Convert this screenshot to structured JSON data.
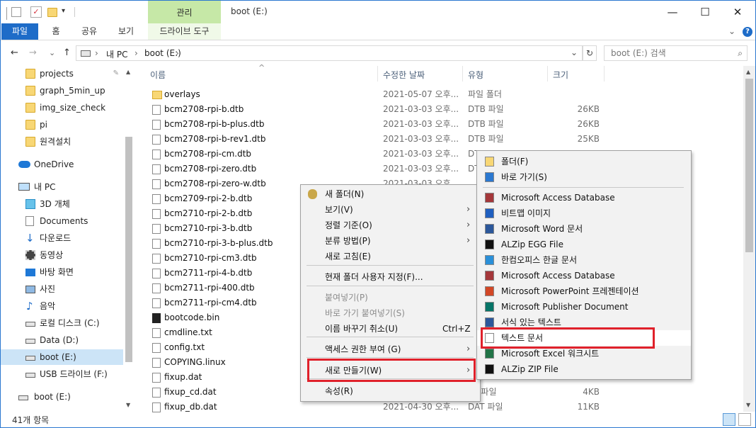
{
  "window": {
    "title": "boot (E:)",
    "context_tab": "관리",
    "minimize": "—",
    "maximize": "☐",
    "close": "✕"
  },
  "ribbon": {
    "tabs": [
      "파일",
      "홈",
      "공유",
      "보기"
    ],
    "context_tab": "드라이브 도구",
    "collapse_icon": "⌄",
    "help_icon": "?"
  },
  "address": {
    "back": "←",
    "forward": "→",
    "recent": "⌄",
    "up": "↑",
    "crumbs": [
      "내 PC",
      "boot (E:)"
    ],
    "sep": "›",
    "dropdown": "⌄",
    "refresh": "↻",
    "search_placeholder": "boot (E:) 검색",
    "search_icon": "⌕"
  },
  "nav": {
    "quick": [
      "projects",
      "graph_5min_up",
      "img_size_check",
      "pi",
      "원격설치"
    ],
    "onedrive": "OneDrive",
    "thispc": "내 PC",
    "pc_items": [
      "3D 개체",
      "Documents",
      "다운로드",
      "동영상",
      "바탕 화면",
      "사진",
      "음악",
      "로컬 디스크 (C:)",
      "Data (D:)",
      "boot (E:)",
      "USB 드라이브 (F:)"
    ],
    "bottom": "boot (E:)",
    "pin_icon": "📌"
  },
  "columns": {
    "name": "이름",
    "date": "수정한 날짜",
    "type": "유형",
    "size": "크기",
    "sort_arrow": "^"
  },
  "files": [
    {
      "name": "overlays",
      "date": "2021-05-07 오후...",
      "type": "파일 폴더",
      "size": "",
      "kind": "folder"
    },
    {
      "name": "bcm2708-rpi-b.dtb",
      "date": "2021-03-03 오후...",
      "type": "DTB 파일",
      "size": "26KB",
      "kind": "file"
    },
    {
      "name": "bcm2708-rpi-b-plus.dtb",
      "date": "2021-03-03 오후...",
      "type": "DTB 파일",
      "size": "26KB",
      "kind": "file"
    },
    {
      "name": "bcm2708-rpi-b-rev1.dtb",
      "date": "2021-03-03 오후...",
      "type": "DTB 파일",
      "size": "25KB",
      "kind": "file"
    },
    {
      "name": "bcm2708-rpi-cm.dtb",
      "date": "2021-03-03 오후...",
      "type": "DT",
      "size": "",
      "kind": "file"
    },
    {
      "name": "bcm2708-rpi-zero.dtb",
      "date": "2021-03-03 오후...",
      "type": "DT",
      "size": "",
      "kind": "file"
    },
    {
      "name": "bcm2708-rpi-zero-w.dtb",
      "date": "2021-03-03 오후...",
      "type": "",
      "size": "",
      "kind": "file"
    },
    {
      "name": "bcm2709-rpi-2-b.dtb",
      "date": "",
      "type": "",
      "size": "",
      "kind": "file"
    },
    {
      "name": "bcm2710-rpi-2-b.dtb",
      "date": "",
      "type": "",
      "size": "",
      "kind": "file"
    },
    {
      "name": "bcm2710-rpi-3-b.dtb",
      "date": "",
      "type": "",
      "size": "",
      "kind": "file"
    },
    {
      "name": "bcm2710-rpi-3-b-plus.dtb",
      "date": "",
      "type": "",
      "size": "",
      "kind": "file"
    },
    {
      "name": "bcm2710-rpi-cm3.dtb",
      "date": "",
      "type": "",
      "size": "",
      "kind": "file"
    },
    {
      "name": "bcm2711-rpi-4-b.dtb",
      "date": "",
      "type": "",
      "size": "",
      "kind": "file"
    },
    {
      "name": "bcm2711-rpi-400.dtb",
      "date": "",
      "type": "",
      "size": "",
      "kind": "file"
    },
    {
      "name": "bcm2711-rpi-cm4.dtb",
      "date": "",
      "type": "",
      "size": "",
      "kind": "file"
    },
    {
      "name": "bootcode.bin",
      "date": "",
      "type": "",
      "size": "",
      "kind": "bin"
    },
    {
      "name": "cmdline.txt",
      "date": "",
      "type": "",
      "size": "",
      "kind": "file"
    },
    {
      "name": "config.txt",
      "date": "",
      "type": "",
      "size": "",
      "kind": "file"
    },
    {
      "name": "COPYING.linux",
      "date": "",
      "type": "",
      "size": "",
      "kind": "file"
    },
    {
      "name": "fixup.dat",
      "date": "",
      "type": "",
      "size": "",
      "kind": "file"
    },
    {
      "name": "fixup_cd.dat",
      "date": "",
      "type": "AT 파일",
      "size": "4KB",
      "kind": "file"
    },
    {
      "name": "fixup_db.dat",
      "date": "2021-04-30 오후...",
      "type": "DAT 파일",
      "size": "11KB",
      "kind": "file"
    }
  ],
  "status": {
    "count": "41개 항목"
  },
  "context_menu": {
    "items": [
      {
        "label": "새 폴더(N)",
        "shortcut": "",
        "arrow": "",
        "disabled": false
      },
      {
        "label": "보기(V)",
        "shortcut": "",
        "arrow": "›",
        "disabled": false
      },
      {
        "label": "정렬 기준(O)",
        "shortcut": "",
        "arrow": "›",
        "disabled": false
      },
      {
        "label": "분류 방법(P)",
        "shortcut": "",
        "arrow": "›",
        "disabled": false
      },
      {
        "label": "새로 고침(E)",
        "shortcut": "",
        "arrow": "",
        "disabled": false
      },
      {
        "label": "현재 폴더 사용자 지정(F)...",
        "shortcut": "",
        "arrow": "",
        "disabled": false
      },
      {
        "label": "붙여넣기(P)",
        "shortcut": "",
        "arrow": "",
        "disabled": true
      },
      {
        "label": "바로 가기 붙여넣기(S)",
        "shortcut": "",
        "arrow": "",
        "disabled": true
      },
      {
        "label": "이름 바꾸기 취소(U)",
        "shortcut": "Ctrl+Z",
        "arrow": "",
        "disabled": false
      },
      {
        "label": "액세스 권한 부여 (G)",
        "shortcut": "",
        "arrow": "›",
        "disabled": false
      },
      {
        "label": "새로 만들기(W)",
        "shortcut": "",
        "arrow": "›",
        "disabled": false
      },
      {
        "label": "속성(R)",
        "shortcut": "",
        "arrow": "",
        "disabled": false
      }
    ]
  },
  "submenu": {
    "items": [
      {
        "label": "폴더(F)",
        "icon": "folder-icon",
        "color": "#f8d775"
      },
      {
        "label": "바로 가기(S)",
        "icon": "shortcut-icon",
        "color": "#2b78d0"
      },
      {
        "label": "Microsoft Access Database",
        "icon": "access-icon",
        "color": "#a4373a"
      },
      {
        "label": "비트맵 이미지",
        "icon": "bitmap-icon",
        "color": "#1f5fbf"
      },
      {
        "label": "Microsoft Word 문서",
        "icon": "word-icon",
        "color": "#2b579a"
      },
      {
        "label": "ALZip EGG File",
        "icon": "egg-icon",
        "color": "#111111"
      },
      {
        "label": "한컴오피스 한글 문서",
        "icon": "hwp-icon",
        "color": "#2a8fd8"
      },
      {
        "label": "Microsoft Access Database",
        "icon": "access-icon",
        "color": "#a4373a"
      },
      {
        "label": "Microsoft PowerPoint 프레젠테이션",
        "icon": "powerpoint-icon",
        "color": "#d24726"
      },
      {
        "label": "Microsoft Publisher Document",
        "icon": "publisher-icon",
        "color": "#077568"
      },
      {
        "label": "서식 있는 텍스트",
        "icon": "rtf-icon",
        "color": "#2b579a"
      },
      {
        "label": "텍스트 문서",
        "icon": "text-doc-icon",
        "color": "#ffffff"
      },
      {
        "label": "Microsoft Excel 워크시트",
        "icon": "excel-icon",
        "color": "#217346"
      },
      {
        "label": "ALZip ZIP File",
        "icon": "zip-icon",
        "color": "#111111"
      }
    ]
  },
  "highlight_color": "#e0212b"
}
